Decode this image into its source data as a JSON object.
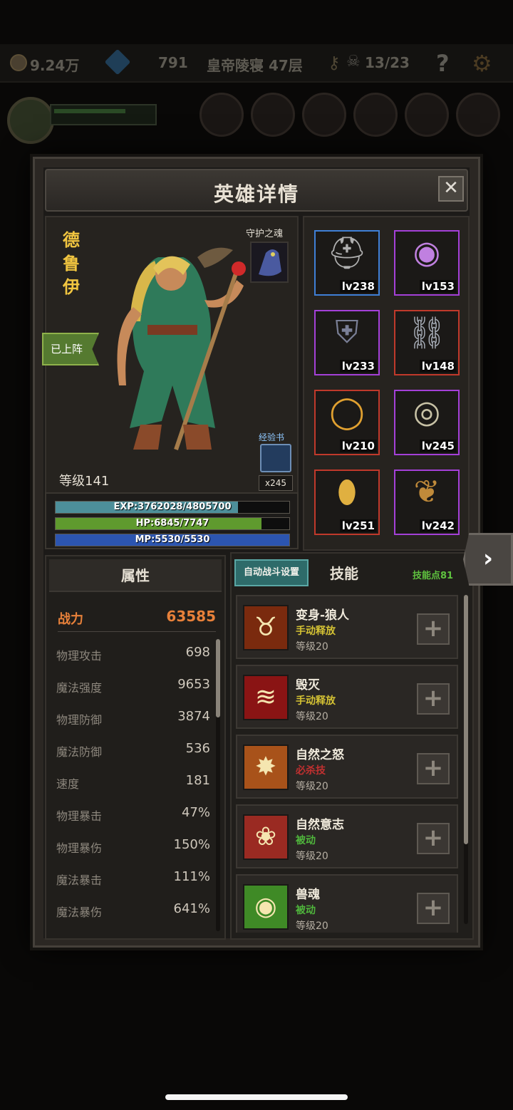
{
  "topbar": {
    "gold": "9.24万",
    "gems": "791",
    "location": "皇帝陵寝 47层",
    "kills": "13/23",
    "help": "?"
  },
  "dialog": {
    "title": "英雄详情",
    "close": "✕"
  },
  "hero": {
    "name": "德鲁伊",
    "status_tag": "已上阵",
    "guardian_label": "守护之魂",
    "expbook_label": "经验书",
    "expbook_count": "x245",
    "level_text": "等级141",
    "exp_text": "EXP:3762028/4805700",
    "exp_fraction": 0.78,
    "hp_text": "HP:6845/7747",
    "hp_fraction": 0.88,
    "mp_text": "MP:5530/5530",
    "mp_fraction": 1.0
  },
  "equipment": [
    {
      "icon": "helmet-icon",
      "glyph": "⛑",
      "level": "lv238",
      "rarity": "blue"
    },
    {
      "icon": "necklace-icon",
      "glyph": "◉",
      "level": "lv153",
      "rarity": "purple"
    },
    {
      "icon": "armor-icon",
      "glyph": "⛨",
      "level": "lv233",
      "rarity": "purple"
    },
    {
      "icon": "boots-icon",
      "glyph": "⛓",
      "level": "lv148",
      "rarity": "red"
    },
    {
      "icon": "ring-gold-icon",
      "glyph": "◯",
      "level": "lv210",
      "rarity": "red"
    },
    {
      "icon": "ring-silver-icon",
      "glyph": "◎",
      "level": "lv245",
      "rarity": "purple"
    },
    {
      "icon": "seed-icon",
      "glyph": "⬮",
      "level": "lv251",
      "rarity": "red"
    },
    {
      "icon": "wing-icon",
      "glyph": "❦",
      "level": "lv242",
      "rarity": "purple"
    }
  ],
  "rarity_colors": {
    "blue": "#3f7fd6",
    "purple": "#a440d8",
    "red": "#c0392b"
  },
  "attributes": {
    "header": "属性",
    "power_label": "战力",
    "power_value": "63585",
    "rows": [
      {
        "label": "物理攻击",
        "value": "698"
      },
      {
        "label": "魔法强度",
        "value": "9653"
      },
      {
        "label": "物理防御",
        "value": "3874"
      },
      {
        "label": "魔法防御",
        "value": "536"
      },
      {
        "label": "速度",
        "value": "181"
      },
      {
        "label": "物理暴击",
        "value": "47%"
      },
      {
        "label": "物理暴伤",
        "value": "150%"
      },
      {
        "label": "魔法暴击",
        "value": "111%"
      },
      {
        "label": "魔法暴伤",
        "value": "641%"
      }
    ]
  },
  "skills": {
    "auto_battle_label": "自动战斗设置",
    "title": "技能",
    "points": "技能点81",
    "items": [
      {
        "name": "变身-狼人",
        "type": "手动释放",
        "type_color": "#d4c234",
        "level": "等级20",
        "icon": "werewolf-icon",
        "glyph": "♉",
        "bg": "#7a2a0e"
      },
      {
        "name": "毁灭",
        "type": "手动释放",
        "type_color": "#d4c234",
        "level": "等级20",
        "icon": "claw-icon",
        "glyph": "≋",
        "bg": "#8a1414"
      },
      {
        "name": "自然之怒",
        "type": "必杀技",
        "type_color": "#c03030",
        "level": "等级20",
        "icon": "fire-icon",
        "glyph": "✸",
        "bg": "#a8521a"
      },
      {
        "name": "自然意志",
        "type": "被动",
        "type_color": "#4fb53c",
        "level": "等级20",
        "icon": "paw-icon",
        "glyph": "❀",
        "bg": "#9a2a22"
      },
      {
        "name": "兽魂",
        "type": "被动",
        "type_color": "#4fb53c",
        "level": "等级20",
        "icon": "spirit-icon",
        "glyph": "◉",
        "bg": "#3f8a26"
      }
    ]
  }
}
